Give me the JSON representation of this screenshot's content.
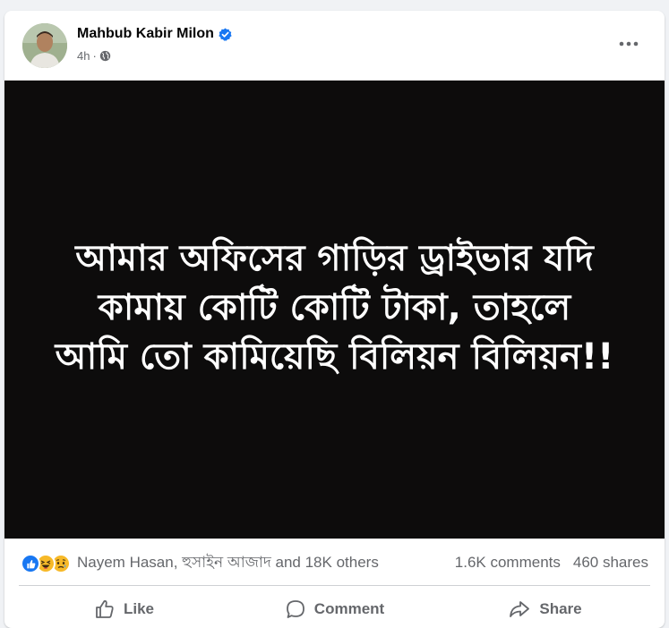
{
  "post": {
    "author": "Mahbub Kabir Milon",
    "verified": true,
    "time": "4h",
    "separator": "·",
    "privacy_icon": "globe-icon",
    "more_icon": "more-options-icon",
    "text_lines": [
      "আমার অফিসের গাড়ির ড্রাইভার যদি",
      "কামায় কোটি কোটি টাকা, তাহলে",
      "আমি তো কামিয়েছি বিলিয়ন বিলিয়ন!!"
    ]
  },
  "stats": {
    "reaction_icons": [
      "like-reaction-icon",
      "haha-reaction-icon",
      "sad-reaction-icon"
    ],
    "reactors": "Nayem Hasan, হুসাইন আজাদ and 18K others",
    "comments": "1.6K comments",
    "shares": "460 shares"
  },
  "actions": {
    "like": "Like",
    "comment": "Comment",
    "share": "Share"
  },
  "colors": {
    "verified": "#1877f2",
    "media_background": "#0d0c0c",
    "secondary_text": "#65676b"
  }
}
